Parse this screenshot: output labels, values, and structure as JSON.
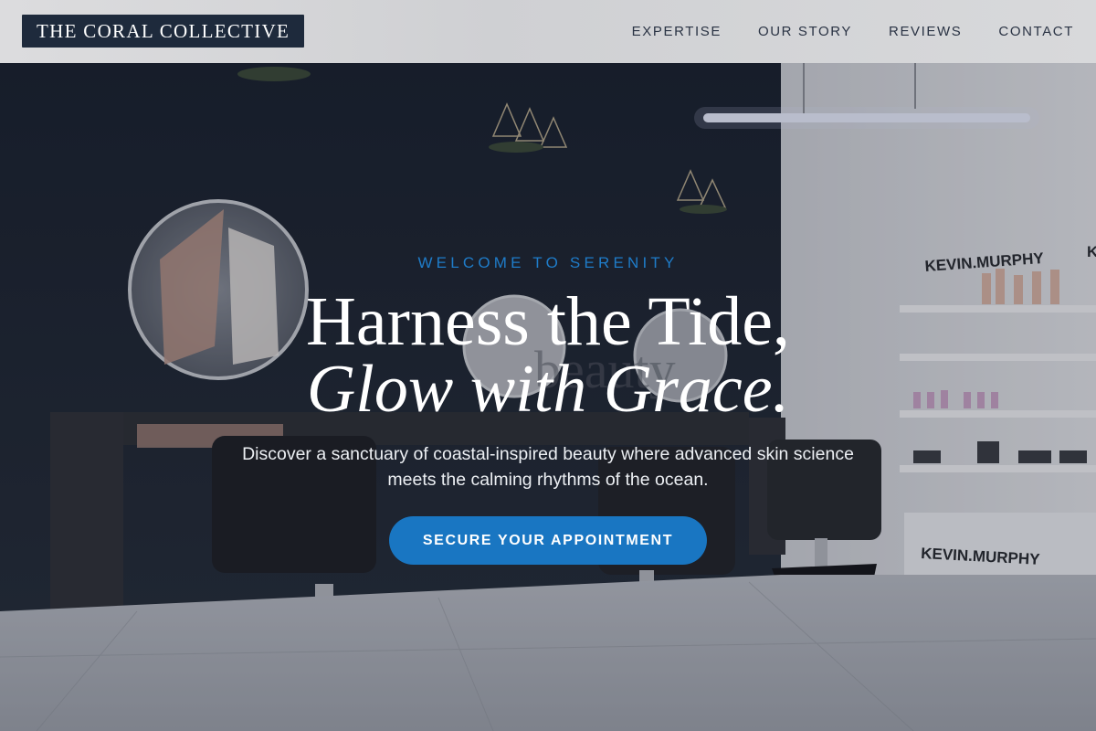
{
  "header": {
    "brand": "THE CORAL COLLECTIVE",
    "nav": [
      {
        "label": "EXPERTISE"
      },
      {
        "label": "OUR STORY"
      },
      {
        "label": "REVIEWS"
      },
      {
        "label": "CONTACT"
      }
    ]
  },
  "hero": {
    "eyebrow": "WELCOME TO SERENITY",
    "title_line1": "Harness the Tide,",
    "title_line2": "Glow with Grace.",
    "subtitle": "Discover a sanctuary of coastal-inspired beauty where advanced skin science meets the calming rhythms of the ocean.",
    "cta_label": "SECURE YOUR APPOINTMENT",
    "background": {
      "wall_text": "beauty",
      "shelf_brand_1": "KEVIN.MURPHY",
      "shelf_brand_2": "KEVIN.MURPHY",
      "shelf_brand_3": "K"
    }
  },
  "colors": {
    "accent": "#1976c2",
    "eyebrow": "#1f7cc9",
    "logo_bg": "#1e2a3c",
    "header_bg": "#d4d5d7"
  }
}
